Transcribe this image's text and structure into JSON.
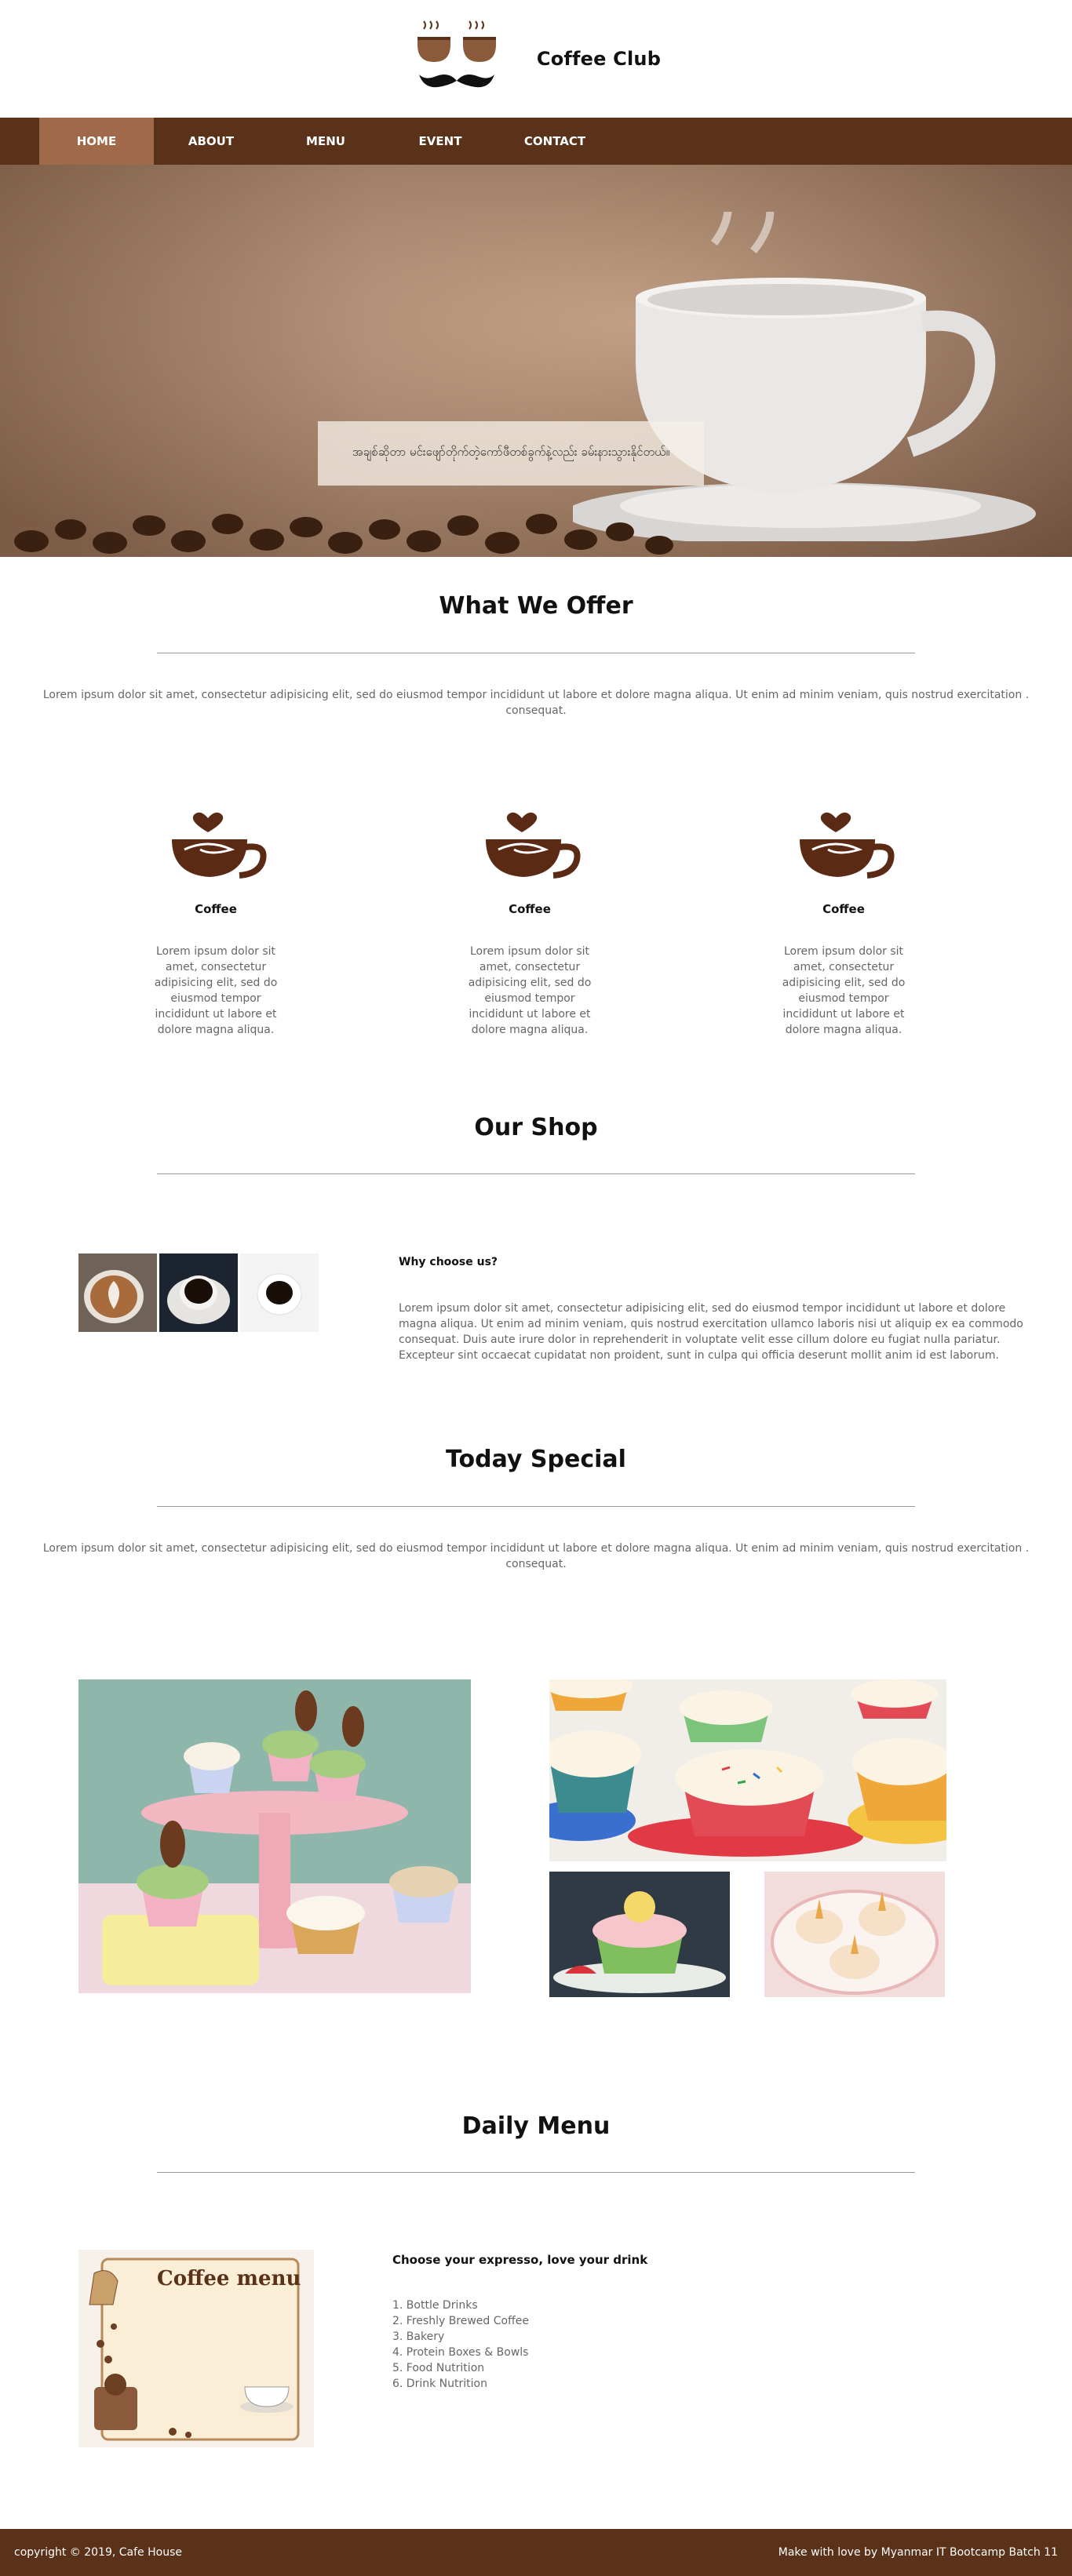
{
  "brand": {
    "name": "Coffee Club"
  },
  "nav": {
    "items": [
      "HOME",
      "ABOUT",
      "MENU",
      "EVENT",
      "CONTACT"
    ],
    "active": "HOME"
  },
  "hero": {
    "caption": "အချစ်ဆိုတာ မင်းဖျော်တိုက်တဲ့ကော်ဖီတစ်ခွက်နဲ့လည်း ခမ်းနားသွားနိုင်တယ်။"
  },
  "offer": {
    "title": "What We Offer",
    "lead": "Lorem ipsum dolor sit amet, consectetur adipisicing elit, sed do eiusmod tempor incididunt ut labore et dolore magna aliqua. Ut enim ad minim veniam, quis nostrud exercitation . consequat.",
    "features": [
      {
        "name": "Coffee",
        "desc": "Lorem ipsum dolor sit amet, consectetur adipisicing elit, sed do eiusmod tempor incididunt ut labore et dolore magna aliqua."
      },
      {
        "name": "Coffee",
        "desc": "Lorem ipsum dolor sit amet, consectetur adipisicing elit, sed do eiusmod tempor incididunt ut labore et dolore magna aliqua."
      },
      {
        "name": "Coffee",
        "desc": "Lorem ipsum dolor sit amet, consectetur adipisicing elit, sed do eiusmod tempor incididunt ut labore et dolore magna aliqua."
      }
    ]
  },
  "shop": {
    "title": "Our Shop",
    "why_title": "Why choose us?",
    "why_text": "Lorem ipsum dolor sit amet, consectetur adipisicing elit, sed do eiusmod tempor incididunt ut labore et dolore magna aliqua. Ut enim ad minim veniam, quis nostrud exercitation ullamco laboris nisi ut aliquip ex ea commodo consequat. Duis aute irure dolor in reprehenderit in voluptate velit esse cillum dolore eu fugiat nulla pariatur. Excepteur sint occaecat cupidatat non proident, sunt in culpa qui officia deserunt mollit anim id est laborum."
  },
  "special": {
    "title": "Today Special",
    "lead": "Lorem ipsum dolor sit amet, consectetur adipisicing elit, sed do eiusmod tempor incididunt ut labore et dolore magna aliqua. Ut enim ad minim veniam, quis nostrud exercitation . consequat."
  },
  "daily_menu": {
    "title": "Daily Menu",
    "card_text": "Coffee menu",
    "heading": "Choose your expresso, love your drink",
    "items": [
      "1. Bottle Drinks",
      "2. Freshly Brewed Coffee",
      "3. Bakery",
      "4. Protein Boxes & Bowls",
      "5. Food Nutrition",
      "6. Drink Nutrition"
    ]
  },
  "footer": {
    "left": "copyright © 2019, Cafe House",
    "right": "Make with love by Myanmar IT Bootcamp Batch 11"
  },
  "colors": {
    "brown": "#5a3219",
    "active": "#a0694a",
    "cup": "#8a5a3a"
  }
}
